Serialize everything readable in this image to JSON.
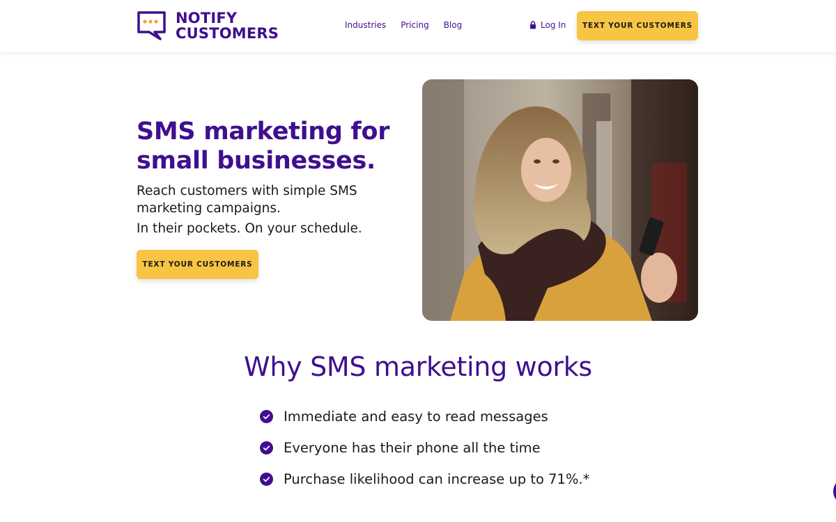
{
  "header": {
    "logo": {
      "line1": "NOTIFY",
      "line2": "CUSTOMERS",
      "icon": "chat-bubble-logo-icon"
    },
    "nav": [
      {
        "label": "Industries"
      },
      {
        "label": "Pricing"
      },
      {
        "label": "Blog"
      }
    ],
    "login": {
      "label": "Log In",
      "icon": "lock-icon"
    },
    "cta": "TEXT YOUR CUSTOMERS"
  },
  "hero": {
    "title": "SMS marketing for small businesses.",
    "subtitle": "Reach customers with simple SMS marketing campaigns.",
    "subtitle2": "In their pockets. On your schedule.",
    "cta": "TEXT YOUR CUSTOMERS"
  },
  "why": {
    "title": "Why SMS marketing works",
    "items": [
      {
        "text": "Immediate and easy to read messages"
      },
      {
        "text": "Everyone has their phone all the time"
      },
      {
        "text": "Purchase likelihood can increase up to 71%.*"
      }
    ]
  },
  "colors": {
    "brand_purple": "#3f0f8f",
    "accent_yellow": "#f7c443",
    "logo_dots": "#f4a23a"
  }
}
